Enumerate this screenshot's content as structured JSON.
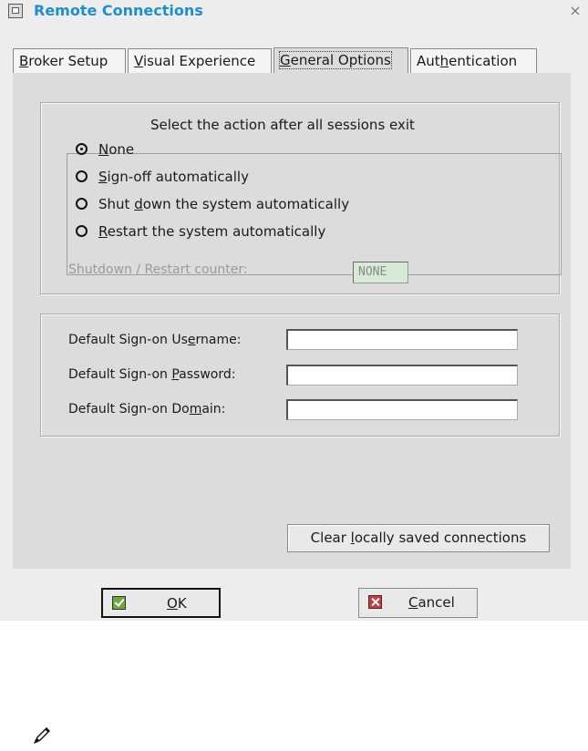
{
  "window": {
    "title": "Remote Connections"
  },
  "tabs": [
    {
      "label_pre": "",
      "label_key": "B",
      "label_post": "roker Setup"
    },
    {
      "label_pre": "",
      "label_key": "V",
      "label_post": "isual Experience"
    },
    {
      "label_pre": "",
      "label_key": "G",
      "label_post": "eneral Options"
    },
    {
      "label_pre": "Aut",
      "label_key": "h",
      "label_post": "entication"
    }
  ],
  "session_exit": {
    "legend": "Select the action after all sessions exit",
    "options": [
      {
        "pre": "",
        "key": "N",
        "post": "one",
        "checked": true
      },
      {
        "pre": "",
        "key": "S",
        "post": "ign-off automatically",
        "checked": false
      },
      {
        "pre": "Shut ",
        "key": "d",
        "post": "own the system automatically",
        "checked": false
      },
      {
        "pre": "",
        "key": "R",
        "post": "estart the system automatically",
        "checked": false
      }
    ],
    "counter_label_pre": "Shutdown / Restart co",
    "counter_label_key": "u",
    "counter_label_post": "nter:",
    "counter_value": "NONE"
  },
  "signon": {
    "username_label_pre": "Default Sign-on Us",
    "username_label_key": "e",
    "username_label_post": "rname:",
    "username_value": "",
    "password_label_pre": "Default Sign-on ",
    "password_label_key": "P",
    "password_label_post": "assword:",
    "password_value": "",
    "domain_label_pre": "Default Sign-on Do",
    "domain_label_key": "m",
    "domain_label_post": "ain:",
    "domain_value": ""
  },
  "clear_button": {
    "pre": "Clear ",
    "key": "l",
    "post": "ocally saved connections"
  },
  "ok_button": {
    "pre": "",
    "key": "O",
    "post": "K"
  },
  "cancel_button": {
    "pre": "",
    "key": "C",
    "post": "ancel"
  },
  "icons": {
    "app": "remote-connections-icon",
    "close": "close-icon",
    "ok": "checkmark-icon",
    "cancel": "x-icon",
    "note": "pencil-note-icon"
  },
  "colors": {
    "title": "#1f8fc7",
    "ok_icon": "#6fa83a",
    "cancel_icon": "#c93b3b",
    "counter_bg": "#d6ead6"
  }
}
